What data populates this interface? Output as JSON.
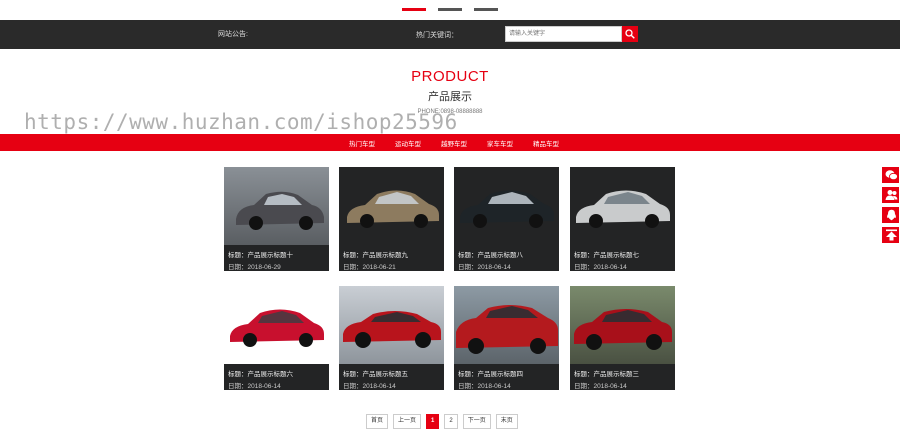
{
  "slider": {
    "dots": 3,
    "active": 0
  },
  "topbar": {
    "notice_label": "网站公告:",
    "hot_keywords_label": "热门关键词：",
    "search_placeholder": "请输入关键字"
  },
  "heading": {
    "en": "PRODUCT",
    "cn": "产品展示",
    "phone": "PHONE:0898-08888888"
  },
  "watermark": "https://www.huzhan.com/ishop25596",
  "categories": [
    "热门车型",
    "运动车型",
    "越野车型",
    "家车车型",
    "精品车型"
  ],
  "products": [
    {
      "title": "标题：产品展示标题十",
      "date": "日期：2018-06-29",
      "color": "#4a4a4f"
    },
    {
      "title": "标题：产品展示标题九",
      "date": "日期：2018-06-21",
      "color": "#8d7b5f"
    },
    {
      "title": "标题：产品展示标题八",
      "date": "日期：2018-06-14",
      "color": "#1e2428"
    },
    {
      "title": "标题：产品展示标题七",
      "date": "日期：2018-06-14",
      "color": "#c9cbcc"
    },
    {
      "title": "标题：产品展示标题六",
      "date": "日期：2018-06-14",
      "color": "#c8102e"
    },
    {
      "title": "标题：产品展示标题五",
      "date": "日期：2018-06-14",
      "color": "#b8141c"
    },
    {
      "title": "标题：产品展示标题四",
      "date": "日期：2018-06-14",
      "color": "#b41a1e"
    },
    {
      "title": "标题：产品展示标题三",
      "date": "日期：2018-06-14",
      "color": "#a8101a"
    }
  ],
  "pager": {
    "first": "首页",
    "prev": "上一页",
    "pages": [
      "1",
      "2"
    ],
    "current": "1",
    "next": "下一页",
    "last": "末页"
  },
  "float_buttons": [
    "wechat-icon",
    "users-icon",
    "qq-icon",
    "back-to-top-icon"
  ],
  "colors": {
    "accent": "#e60012",
    "dark": "#2a2a2a"
  }
}
